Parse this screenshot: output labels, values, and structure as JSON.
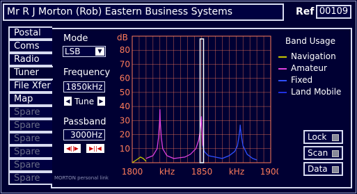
{
  "header": {
    "title": "Mr R J Morton (Rob)  Eastern Business Systems",
    "ref_label": "Ref",
    "ref_value": "00109"
  },
  "tabs": [
    {
      "label": "Postal",
      "active": false,
      "spare": false
    },
    {
      "label": "Coms",
      "active": false,
      "spare": false
    },
    {
      "label": "Radio",
      "active": false,
      "spare": false
    },
    {
      "label": "Tuner",
      "active": true,
      "spare": false
    },
    {
      "label": "File Xfer",
      "active": false,
      "spare": false
    },
    {
      "label": "Map",
      "active": false,
      "spare": false
    },
    {
      "label": "Spare",
      "active": false,
      "spare": true
    },
    {
      "label": "Spare",
      "active": false,
      "spare": true
    },
    {
      "label": "Spare",
      "active": false,
      "spare": true
    },
    {
      "label": "Spare",
      "active": false,
      "spare": true
    },
    {
      "label": "Spare",
      "active": false,
      "spare": true
    },
    {
      "label": "Spare",
      "active": false,
      "spare": true
    }
  ],
  "controls": {
    "mode_label": "Mode",
    "mode_value": "LSB",
    "frequency_label": "Frequency",
    "frequency_value": "1850kHz",
    "tune_label": "Tune",
    "passband_label": "Passband",
    "passband_value": "3000Hz"
  },
  "legend": {
    "title": "Band Usage",
    "items": [
      {
        "label": "Navigation",
        "color": "#c8c800"
      },
      {
        "label": "Amateur",
        "color": "#e040e0"
      },
      {
        "label": "Fixed",
        "color": "#3050ff"
      },
      {
        "label": "Land Mobile",
        "color": "#2030e0"
      }
    ]
  },
  "side_buttons": {
    "lock": "Lock",
    "scan": "Scan",
    "data": "Data"
  },
  "brand": "MORTON personal link",
  "chart_data": {
    "type": "line",
    "ylabel": "dB",
    "ylim": [
      0,
      90
    ],
    "yticks": [
      10,
      20,
      30,
      40,
      50,
      60,
      70,
      80
    ],
    "xlim": [
      1800,
      1900
    ],
    "x_tick_labels": [
      "1800",
      "kHz",
      "1850",
      "kHz",
      "1900"
    ],
    "grid": true,
    "cursor_x": 1850,
    "series": [
      {
        "name": "Navigation",
        "color": "#c8c800",
        "x": [
          1800,
          1803,
          1806,
          1808,
          1810
        ],
        "y": [
          0,
          2,
          4,
          3,
          1
        ]
      },
      {
        "name": "Amateur",
        "color": "#e040e0",
        "x": [
          1810,
          1815,
          1818,
          1819,
          1819.8,
          1820,
          1820.2,
          1821,
          1822,
          1825,
          1830,
          1838,
          1842,
          1846,
          1848,
          1849,
          1849.8,
          1850,
          1850.3,
          1851
        ],
        "y": [
          3,
          5,
          10,
          18,
          30,
          38,
          30,
          18,
          10,
          5,
          3,
          4,
          6,
          10,
          16,
          22,
          30,
          33,
          25,
          12
        ]
      },
      {
        "name": "Fixed",
        "color": "#3050ff",
        "x": [
          1851,
          1852,
          1855,
          1860,
          1865,
          1870,
          1874,
          1876,
          1877,
          1877.8,
          1878,
          1878.2,
          1879,
          1880,
          1883,
          1887,
          1890
        ],
        "y": [
          12,
          8,
          5,
          4,
          3,
          5,
          8,
          12,
          18,
          24,
          27,
          24,
          18,
          12,
          6,
          3,
          2
        ]
      }
    ]
  }
}
